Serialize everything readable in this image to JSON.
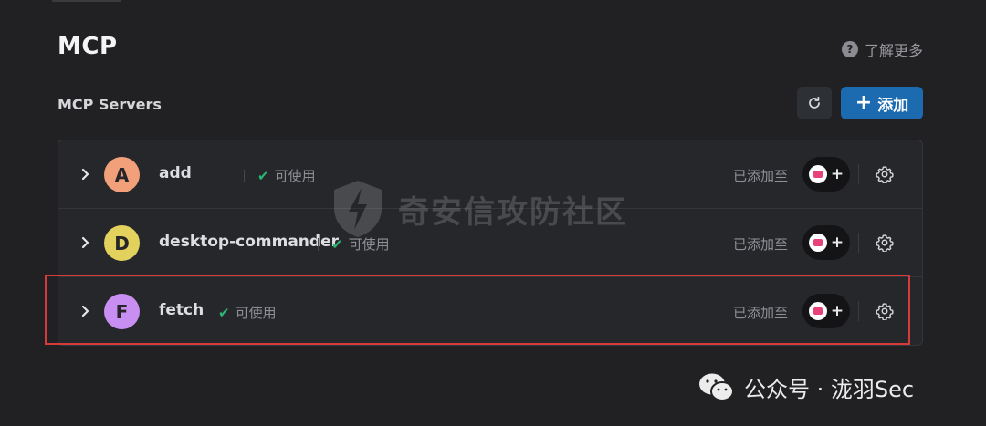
{
  "header": {
    "title": "MCP",
    "learn_more": "了解更多",
    "learn_more_icon": "question-circle-icon"
  },
  "section": {
    "title": "MCP Servers",
    "refresh_icon": "refresh-icon",
    "add_label": "添加"
  },
  "servers": [
    {
      "initial": "A",
      "name": "add",
      "status": "可使用",
      "avatar_color": "#f2a07a",
      "added_label": "已添加至"
    },
    {
      "initial": "D",
      "name": "desktop-commander",
      "status": "可使用",
      "avatar_color": "#e3d15e",
      "added_label": "已添加至"
    },
    {
      "initial": "F",
      "name": "fetch",
      "status": "可使用",
      "avatar_color": "#c98ef2",
      "added_label": "已添加至"
    }
  ],
  "colors": {
    "background": "#212123",
    "accent": "#1c6bb0",
    "status_ok": "#2bb673",
    "highlight": "#d63a3a"
  },
  "watermark": {
    "text": "奇安信攻防社区"
  },
  "footer": {
    "text": "公众号 · 泷羽Sec"
  }
}
